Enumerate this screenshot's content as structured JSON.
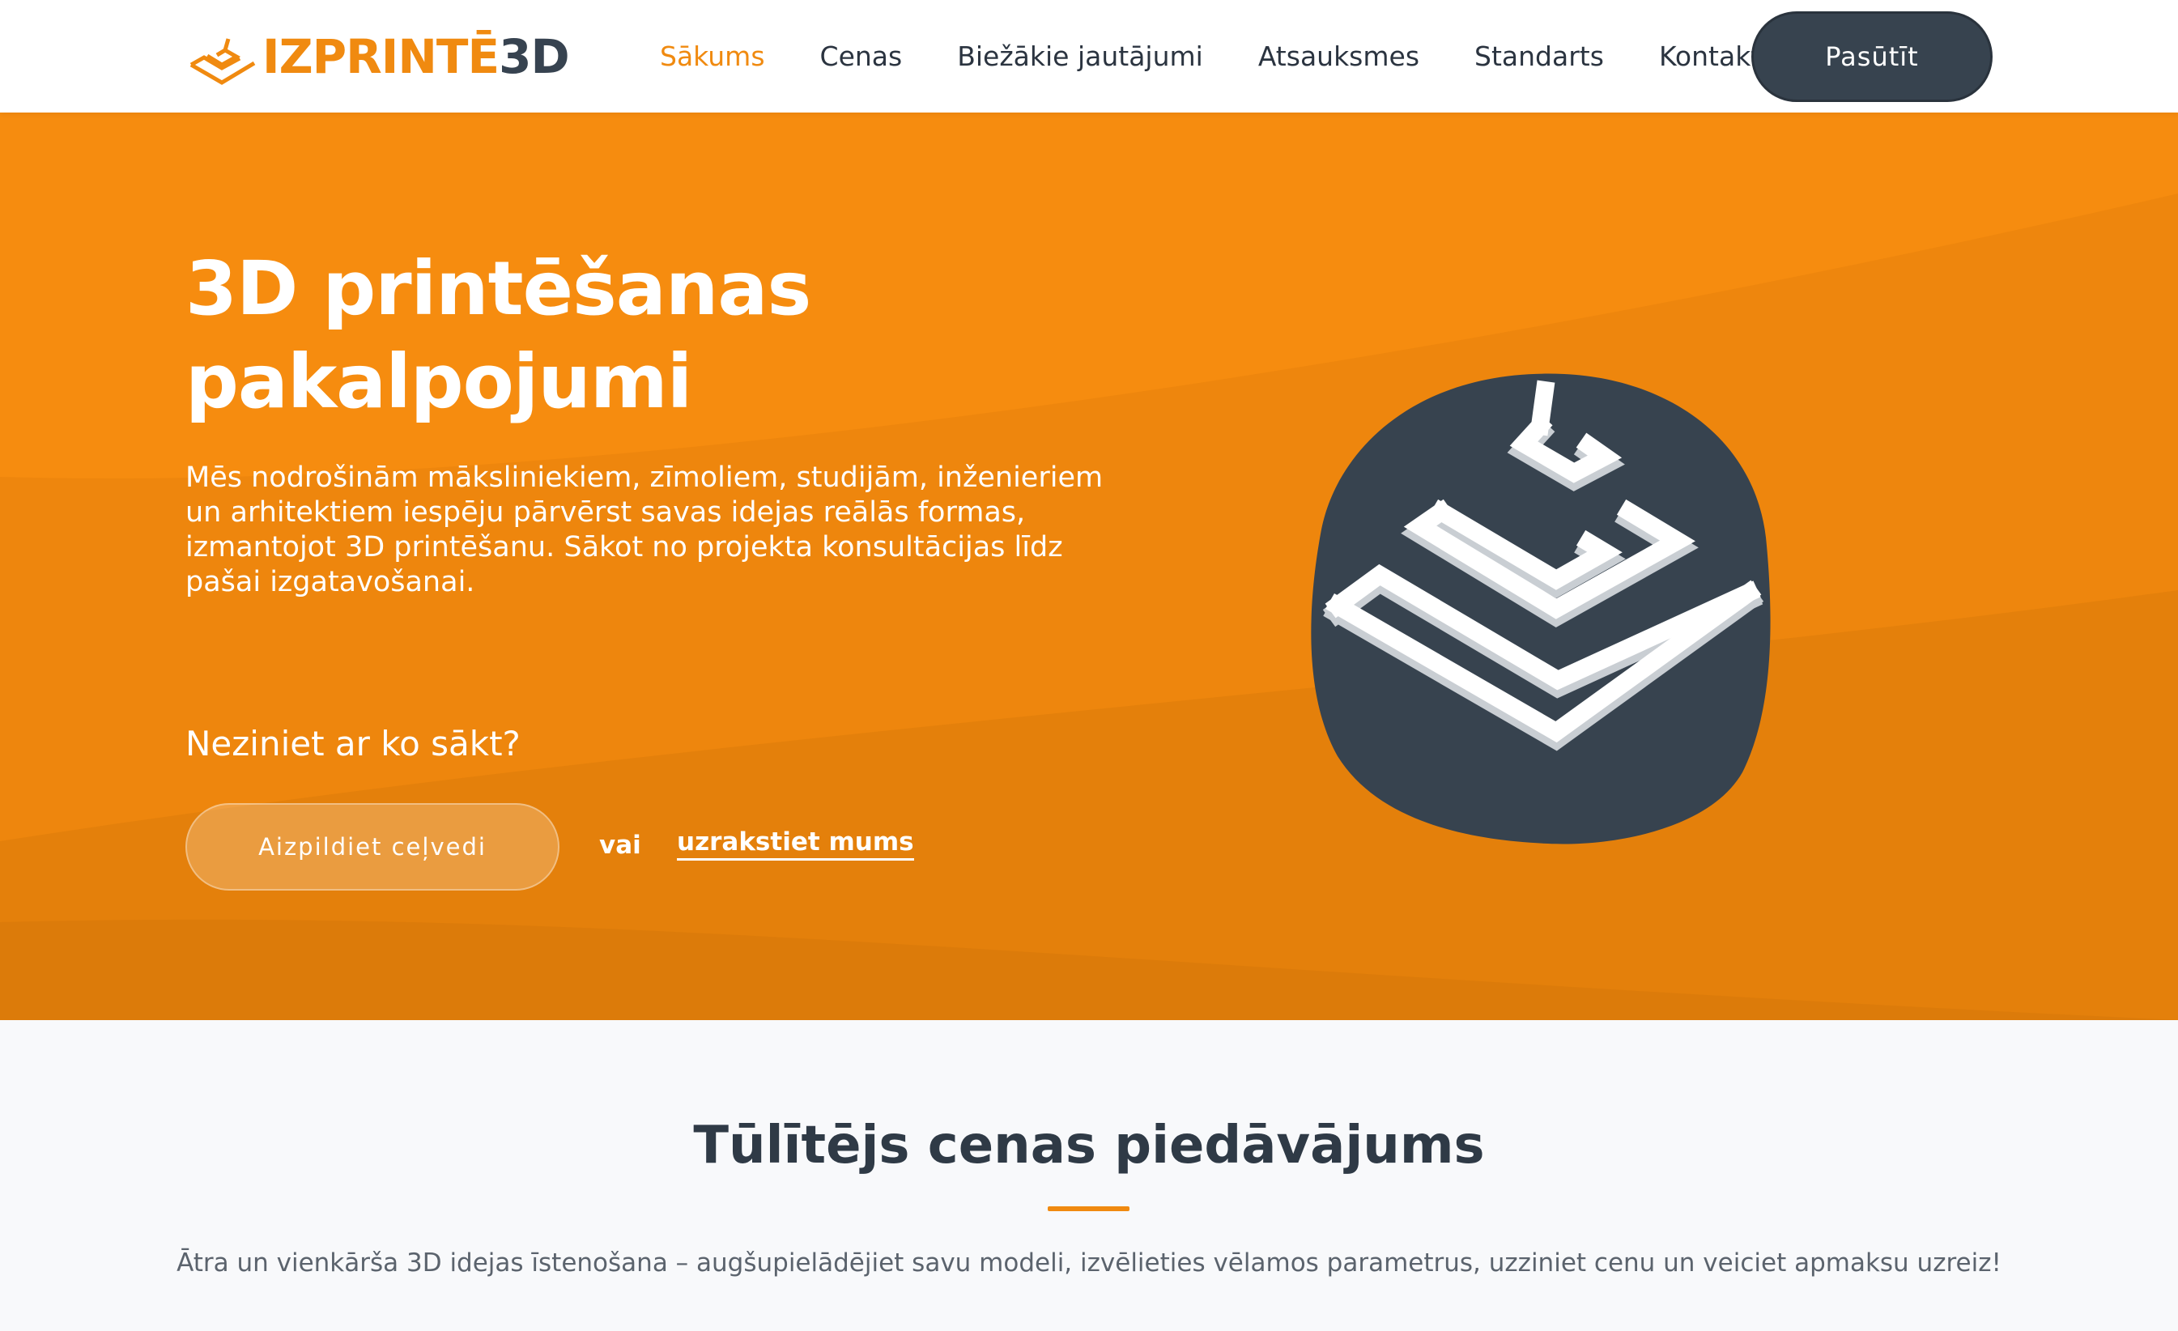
{
  "header": {
    "logo": {
      "part_a": "IZPRINTĒ",
      "part_b": "3D"
    },
    "nav": [
      {
        "label": "Sākums",
        "active": true
      },
      {
        "label": "Cenas",
        "active": false
      },
      {
        "label": "Biežākie jautājumi",
        "active": false
      },
      {
        "label": "Atsauksmes",
        "active": false
      },
      {
        "label": "Standarts",
        "active": false
      },
      {
        "label": "Kontakti",
        "active": false
      }
    ],
    "order_button": "Pasūtīt"
  },
  "hero": {
    "title_line1": "3D printēšanas",
    "title_line2": "pakalpojumi",
    "description": "Mēs nodrošinām māksliniekiem, zīmoliem, studijām, inženieriem un arhitektiem iespēju pārvērst savas idejas reālās formas, izmantojot 3D printēšanu. Sākot no projekta konsultācijas līdz pašai izgatavošanai.",
    "question": "Neziniet ar ko sākt?",
    "guide_button": "Aizpildiet ceļvedi",
    "or_text": "vai",
    "write_link": "uzrakstiet mums",
    "art_icon": "layered-print-icon"
  },
  "quote_section": {
    "title": "Tūlītējs cenas piedāvājums",
    "subtitle": "Ātra un vienkārša 3D idejas īstenošana – augšupielādējiet savu modeli, izvēlieties vēlamos parametrus, uzziniet cenu un veiciet apmaksu uzreiz!"
  },
  "colors": {
    "accent": "#f08a10",
    "dark": "#37434f",
    "hero_bg": "#f58b10"
  }
}
